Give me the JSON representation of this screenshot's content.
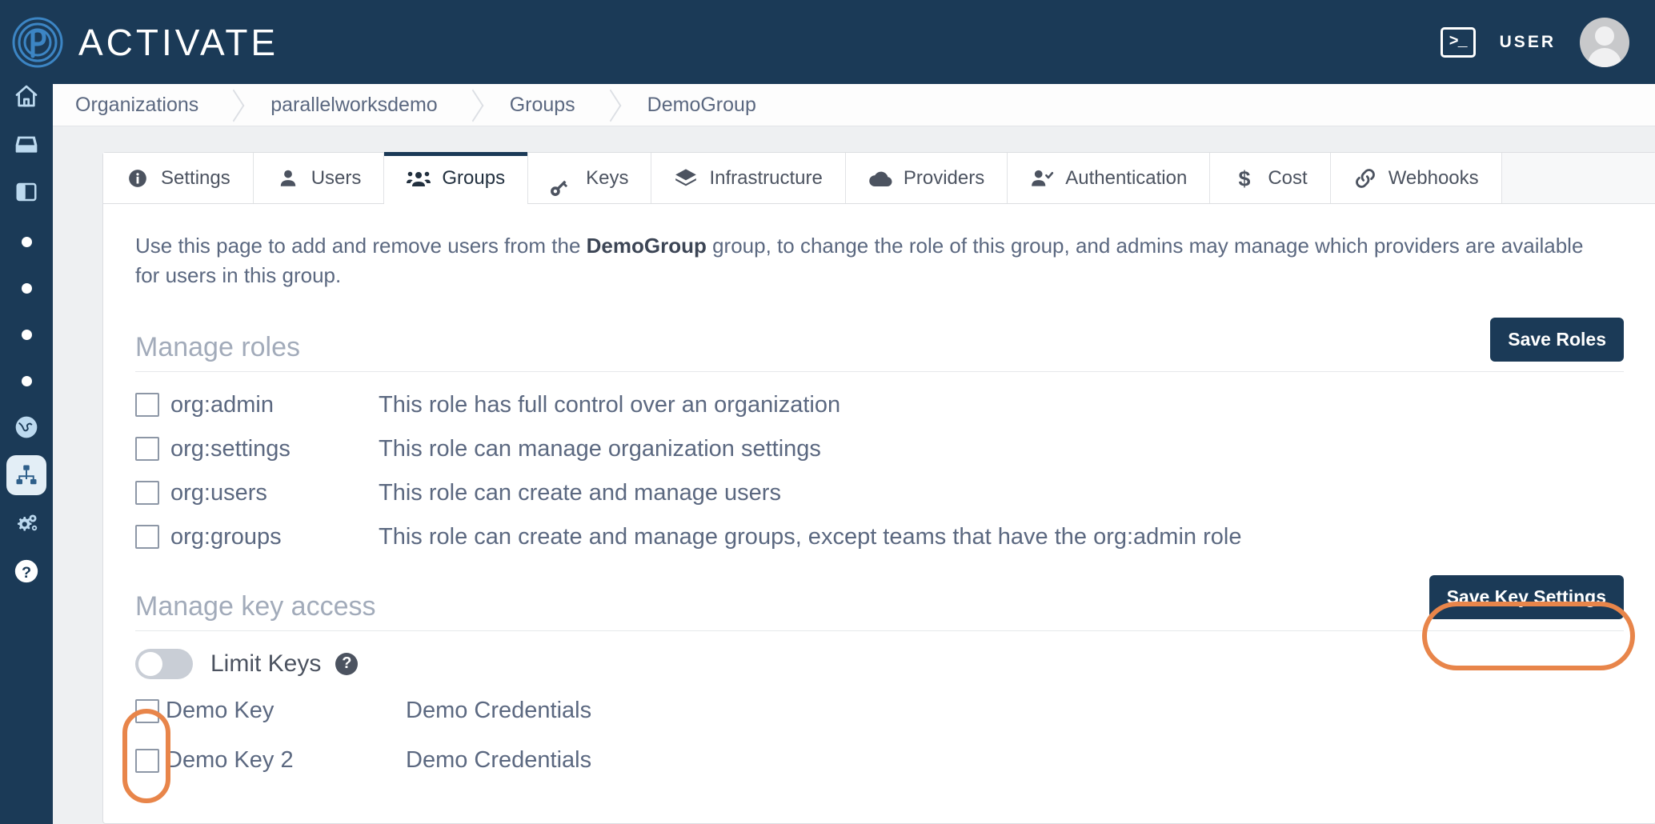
{
  "app": {
    "brand_name": "ACTIVATE",
    "user_label": "USER",
    "terminal_glyph": ">_"
  },
  "breadcrumb": {
    "items": [
      {
        "label": "Organizations"
      },
      {
        "label": "parallelworksdemo"
      },
      {
        "label": "Groups"
      },
      {
        "label": "DemoGroup"
      }
    ]
  },
  "sidebar": {
    "items": [
      {
        "name": "home",
        "icon": "home-icon"
      },
      {
        "name": "inbox",
        "icon": "inbox-icon"
      },
      {
        "name": "panel",
        "icon": "panel-icon"
      },
      {
        "name": "dot-1",
        "icon": "dot-icon"
      },
      {
        "name": "dot-2",
        "icon": "dot-icon"
      },
      {
        "name": "dot-3",
        "icon": "dot-icon"
      },
      {
        "name": "dot-4",
        "icon": "dot-icon"
      },
      {
        "name": "globe",
        "icon": "globe-icon"
      },
      {
        "name": "org-chart",
        "icon": "org-chart-icon",
        "active": true
      },
      {
        "name": "settings",
        "icon": "gears-icon"
      },
      {
        "name": "help",
        "icon": "question-circle-icon"
      }
    ]
  },
  "tabs": [
    {
      "label": "Settings",
      "icon": "info-circle-icon",
      "active": false
    },
    {
      "label": "Users",
      "icon": "user-icon",
      "active": false
    },
    {
      "label": "Groups",
      "icon": "users-group-icon",
      "active": true
    },
    {
      "label": "Keys",
      "icon": "key-icon",
      "active": false
    },
    {
      "label": "Infrastructure",
      "icon": "layers-icon",
      "active": false
    },
    {
      "label": "Providers",
      "icon": "cloud-icon",
      "active": false
    },
    {
      "label": "Authentication",
      "icon": "user-check-icon",
      "active": false
    },
    {
      "label": "Cost",
      "icon": "dollar-icon",
      "active": false
    },
    {
      "label": "Webhooks",
      "icon": "link-icon",
      "active": false
    }
  ],
  "intro": {
    "part1": "Use this page to add and remove users from the ",
    "group_name": "DemoGroup",
    "part2": " group, to change the role of this group, and admins may manage which providers are available for users in this group."
  },
  "manage_roles": {
    "title": "Manage roles",
    "save_label": "Save Roles",
    "rows": [
      {
        "name": "org:admin",
        "description": "This role has full control over an organization",
        "checked": false
      },
      {
        "name": "org:settings",
        "description": "This role can manage organization settings",
        "checked": false
      },
      {
        "name": "org:users",
        "description": "This role can create and manage users",
        "checked": false
      },
      {
        "name": "org:groups",
        "description": "This role can create and manage groups, except teams that have the org:admin role",
        "checked": false
      }
    ]
  },
  "manage_key_access": {
    "title": "Manage key access",
    "save_label": "Save Key Settings",
    "toggle_label": "Limit Keys",
    "toggle_on": false,
    "help_glyph": "?",
    "keys": [
      {
        "name": "Demo Key",
        "credential": "Demo Credentials",
        "checked": false
      },
      {
        "name": "Demo Key 2",
        "credential": "Demo Credentials",
        "checked": false
      }
    ]
  },
  "colors": {
    "brand_navy": "#1b3a57",
    "highlight_orange": "#e8854a",
    "text_muted": "#5b6880",
    "section_title": "#a2abba"
  }
}
